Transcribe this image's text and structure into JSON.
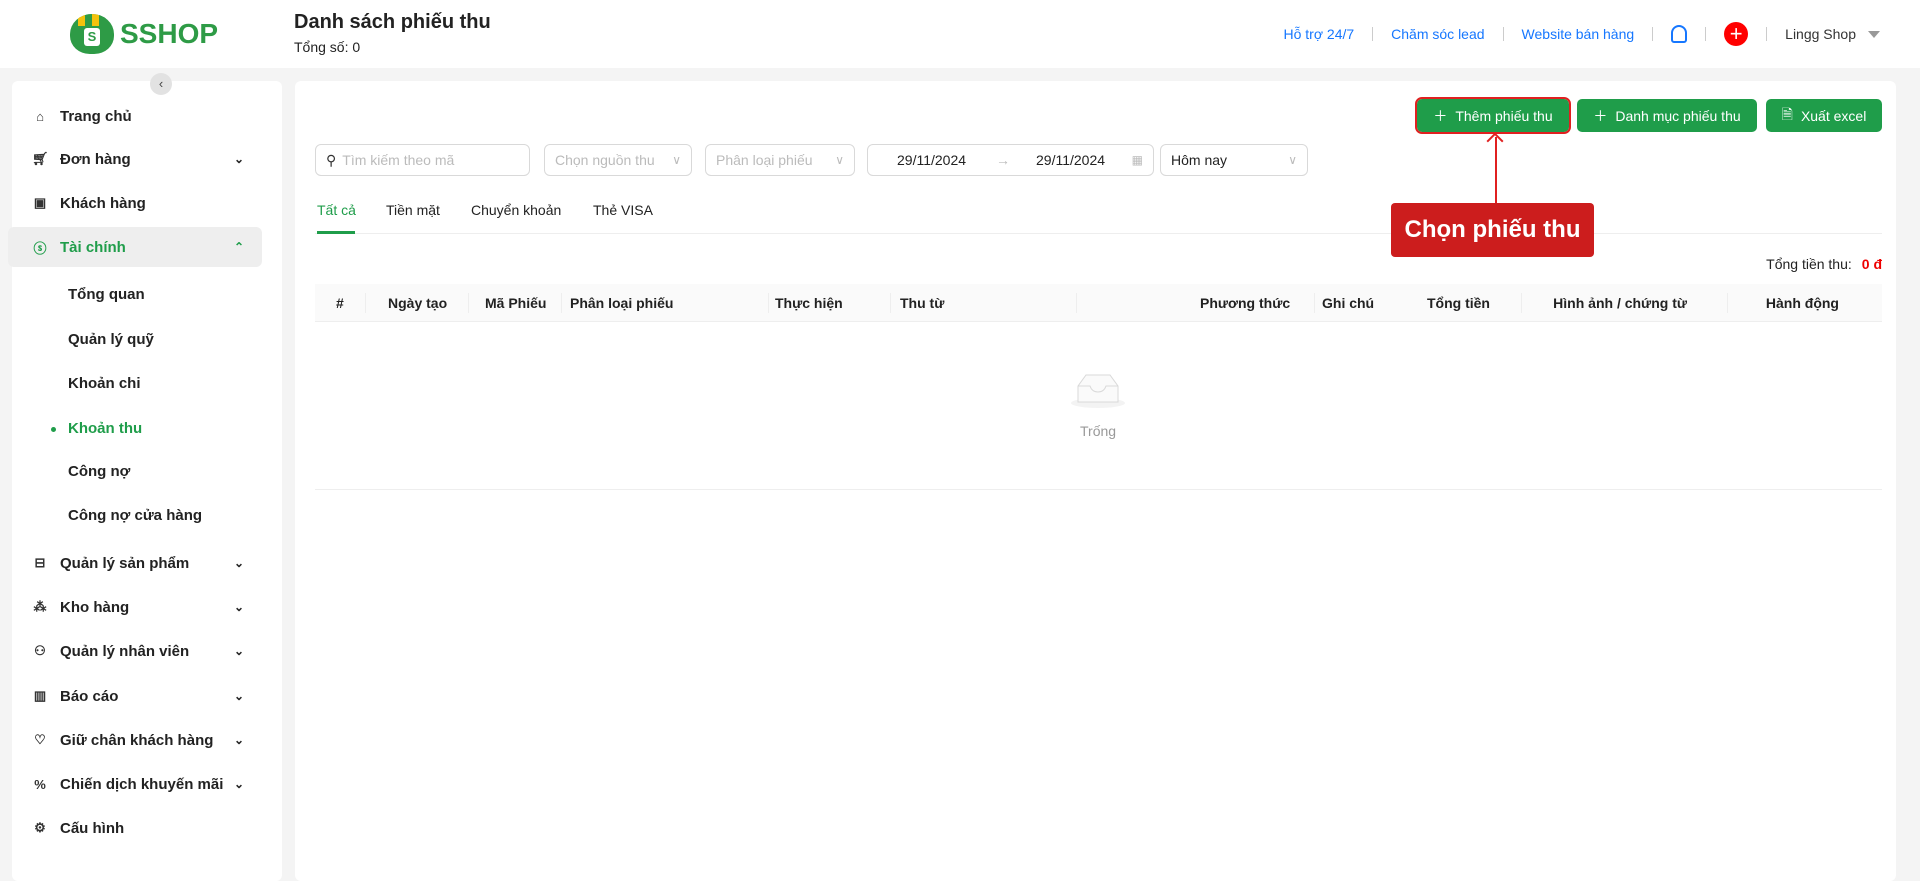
{
  "header": {
    "logo": "SSHOP",
    "title": "Danh sách phiếu thu",
    "subtitle": "Tổng số: 0",
    "links": [
      "Hỗ trợ 24/7",
      "Chăm sóc lead",
      "Website bán hàng"
    ],
    "user": "Lingg Shop"
  },
  "sidebar": {
    "items": [
      {
        "label": "Trang chủ",
        "icon": "home-icon"
      },
      {
        "label": "Đơn hàng",
        "icon": "cart-icon"
      },
      {
        "label": "Khách hàng",
        "icon": "contact-icon"
      },
      {
        "label": "Tài chính",
        "icon": "dollar-icon"
      },
      {
        "label": "Quản lý sản phẩm",
        "icon": "box-icon"
      },
      {
        "label": "Kho hàng",
        "icon": "warehouse-icon"
      },
      {
        "label": "Quản lý nhân viên",
        "icon": "users-icon"
      },
      {
        "label": "Báo cáo",
        "icon": "chart-icon"
      },
      {
        "label": "Giữ chân khách hàng",
        "icon": "heart-icon"
      },
      {
        "label": "Chiến dịch khuyến mãi",
        "icon": "discount-icon"
      },
      {
        "label": "Cấu hình",
        "icon": "gear-icon"
      }
    ],
    "finance_sub": [
      "Tổng quan",
      "Quản lý quỹ",
      "Khoản chi",
      "Khoản thu",
      "Công nợ",
      "Công nợ cửa hàng"
    ]
  },
  "toolbar": {
    "add": "Thêm phiếu thu",
    "category": "Danh mục phiếu thu",
    "export": "Xuất excel"
  },
  "filters": {
    "search_placeholder": "Tìm kiếm theo mã",
    "source": "Chọn nguồn thu",
    "type": "Phân loại phiếu",
    "date_from": "29/11/2024",
    "date_to": "29/11/2024",
    "period": "Hôm nay"
  },
  "tabs": [
    "Tất cả",
    "Tiền mặt",
    "Chuyển khoản",
    "Thẻ VISA"
  ],
  "annotation": "Chọn phiếu thu",
  "summary": {
    "label": "Tổng tiền thu:",
    "value": "0 đ"
  },
  "table": {
    "columns": [
      "#",
      "Ngày tạo",
      "Mã Phiếu",
      "Phân loại phiếu",
      "Thực hiện",
      "Thu từ",
      "Tổng tiền",
      "Phương thức",
      "Ghi chú",
      "Hình ảnh / chứng từ",
      "Hành động"
    ],
    "empty": "Trống"
  },
  "colors": {
    "brand": "#1f9d4a",
    "highlight": "#cc1d1d"
  }
}
